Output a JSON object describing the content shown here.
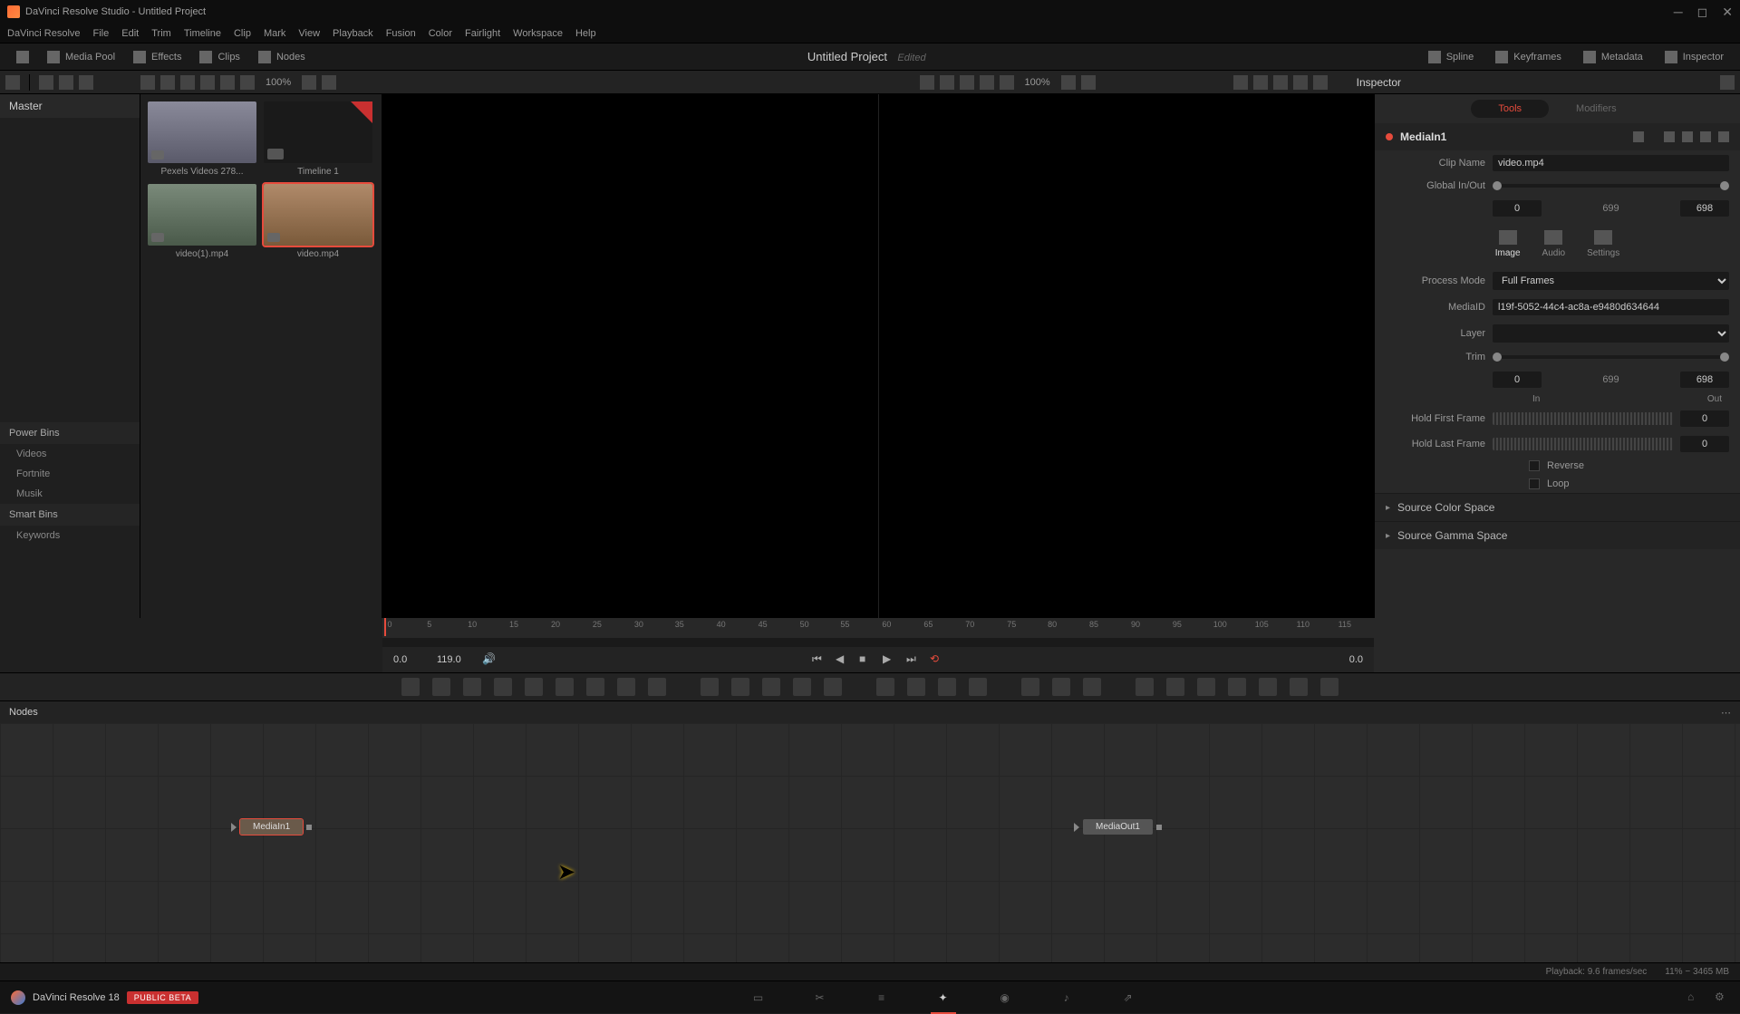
{
  "titlebar": {
    "text": "DaVinci Resolve Studio - Untitled Project"
  },
  "menubar": [
    "DaVinci Resolve",
    "File",
    "Edit",
    "Trim",
    "Timeline",
    "Clip",
    "Mark",
    "View",
    "Playback",
    "Fusion",
    "Color",
    "Fairlight",
    "Workspace",
    "Help"
  ],
  "project": {
    "title": "Untitled Project",
    "status": "Edited"
  },
  "top_toolbar": {
    "left": [
      {
        "name": "media-pool-toggle",
        "label": "Media Pool"
      },
      {
        "name": "effects-toggle",
        "label": "Effects"
      },
      {
        "name": "clips-toggle",
        "label": "Clips"
      },
      {
        "name": "nodes-toggle",
        "label": "Nodes"
      }
    ],
    "right": [
      {
        "name": "spline-toggle",
        "label": "Spline"
      },
      {
        "name": "keyframes-toggle",
        "label": "Keyframes"
      },
      {
        "name": "metadata-toggle",
        "label": "Metadata"
      },
      {
        "name": "inspector-toggle",
        "label": "Inspector"
      }
    ]
  },
  "zoom": {
    "left": "100%",
    "right": "100%"
  },
  "bins": {
    "master": "Master",
    "power_header": "Power Bins",
    "power": [
      "Videos",
      "Fortnite",
      "Musik"
    ],
    "smart_header": "Smart Bins",
    "smart": [
      "Keywords"
    ]
  },
  "clips": [
    {
      "name": "Pexels Videos 278...",
      "type": "video"
    },
    {
      "name": "Timeline 1",
      "type": "timeline"
    },
    {
      "name": "video(1).mp4",
      "type": "video"
    },
    {
      "name": "video.mp4",
      "type": "video",
      "selected": true
    }
  ],
  "viewer": {
    "ruler_ticks": [
      "0",
      "5",
      "10",
      "15",
      "20",
      "25",
      "30",
      "35",
      "40",
      "45",
      "50",
      "55",
      "60",
      "65",
      "70",
      "75",
      "80",
      "85",
      "90",
      "95",
      "100",
      "105",
      "110",
      "115"
    ],
    "time_in": "0.0",
    "time_out": "119.0",
    "time_current": "0.0"
  },
  "inspector": {
    "title": "Inspector",
    "tabs": {
      "tools": "Tools",
      "modifiers": "Modifiers"
    },
    "node_name": "MediaIn1",
    "clip_name_label": "Clip Name",
    "clip_name": "video.mp4",
    "global_label": "Global In/Out",
    "global_in": "0",
    "global_mid": "699",
    "global_out": "698",
    "sub_tabs": {
      "image": "Image",
      "audio": "Audio",
      "settings": "Settings"
    },
    "process_mode_label": "Process Mode",
    "process_mode": "Full Frames",
    "media_id_label": "MediaID",
    "media_id": "l19f-5052-44c4-ac8a-e9480d634644",
    "layer_label": "Layer",
    "trim_label": "Trim",
    "trim_in": "0",
    "trim_mid": "699",
    "trim_out": "698",
    "in_label": "In",
    "out_label": "Out",
    "hold_first_label": "Hold First Frame",
    "hold_first": "0",
    "hold_last_label": "Hold Last Frame",
    "hold_last": "0",
    "reverse_label": "Reverse",
    "loop_label": "Loop",
    "source_color": "Source Color Space",
    "source_gamma": "Source Gamma Space"
  },
  "nodes": {
    "header": "Nodes",
    "media_in": "MediaIn1",
    "media_out": "MediaOut1"
  },
  "status": {
    "playback": "Playback: 9.6 frames/sec",
    "mem": "11% − 3465 MB"
  },
  "bottom": {
    "app": "DaVinci Resolve 18",
    "beta": "PUBLIC BETA"
  }
}
